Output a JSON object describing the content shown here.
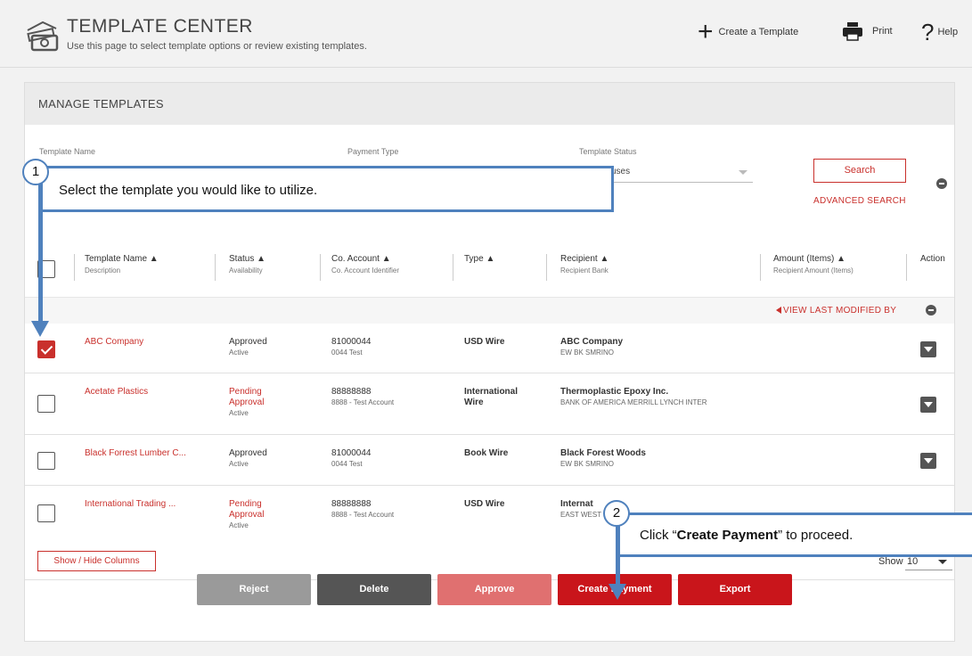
{
  "header": {
    "title": "TEMPLATE CENTER",
    "subtitle": "Use this page to select template options or review existing templates.",
    "actions": {
      "create": "Create a Template",
      "print": "Print",
      "help": "Help"
    }
  },
  "manage": {
    "title": "MANAGE TEMPLATES",
    "filters": {
      "name_label": "Template Name",
      "payment_label": "Payment Type",
      "status_label": "Template Status",
      "status_value": "uses"
    },
    "search_label": "Search",
    "advanced_search": "ADVANCED SEARCH"
  },
  "table": {
    "columns": [
      {
        "title": "Template Name ▲",
        "sub": "Description"
      },
      {
        "title": "Status ▲",
        "sub": "Availability"
      },
      {
        "title": "Co. Account ▲",
        "sub": "Co. Account Identifier"
      },
      {
        "title": "Type ▲",
        "sub": ""
      },
      {
        "title": "Recipient ▲",
        "sub": "Recipient Bank"
      },
      {
        "title": "Amount (Items) ▲",
        "sub": "Recipient Amount (Items)"
      },
      {
        "title": "Action",
        "sub": ""
      }
    ],
    "last_modified": "VIEW LAST MODIFIED BY",
    "rows": [
      {
        "checked": true,
        "name": "ABC Company",
        "status": "Approved",
        "availability": "Active",
        "account": "81000044",
        "account_id": "0044 Test",
        "type": "USD Wire",
        "recipient": "ABC Company",
        "bank": "EW BK SMRINO"
      },
      {
        "checked": false,
        "name": "Acetate Plastics",
        "status": "Pending Approval",
        "availability": "Active",
        "account": "88888888",
        "account_id": "8888 - Test Account",
        "type": "International Wire",
        "recipient": "Thermoplastic Epoxy Inc.",
        "bank": "BANK OF AMERICA MERRILL LYNCH INTER"
      },
      {
        "checked": false,
        "name": "Black Forrest Lumber C...",
        "status": "Approved",
        "availability": "Active",
        "account": "81000044",
        "account_id": "0044 Test",
        "type": "Book Wire",
        "recipient": "Black Forest Woods",
        "bank": "EW BK SMRINO"
      },
      {
        "checked": false,
        "name": "International Trading ...",
        "status": "Pending Approval",
        "availability": "Active",
        "account": "88888888",
        "account_id": "8888 - Test Account",
        "type": "USD Wire",
        "recipient": "Internat",
        "bank": "EAST WEST"
      }
    ]
  },
  "footer": {
    "show_hide": "Show / Hide Columns",
    "show_label": "Show",
    "show_value": "10",
    "buttons": {
      "reject": "Reject",
      "delete": "Delete",
      "approve": "Approve",
      "create_payment": "Create Payment",
      "export": "Export"
    }
  },
  "callouts": {
    "one_num": "1",
    "one_text": "Select the template you would like to utilize.",
    "two_num": "2",
    "two_pre": "Click “",
    "two_bold": "Create Payment",
    "two_post": "” to proceed."
  },
  "colors": {
    "accent": "#c9302c",
    "callout": "#4f81bd",
    "reject": "#9a9a9a",
    "delete": "#555555",
    "approve": "#e07070"
  }
}
